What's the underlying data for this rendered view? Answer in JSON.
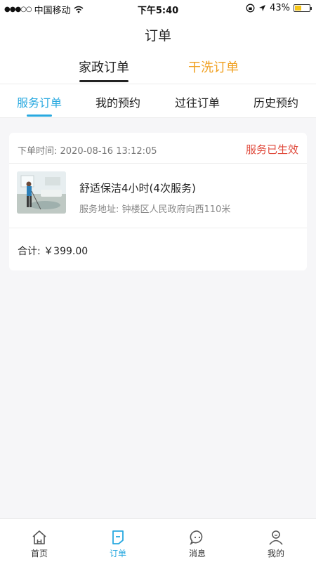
{
  "status_bar": {
    "carrier": "中国移动",
    "time": "下午5:40",
    "battery": "43%"
  },
  "nav": {
    "title": "订单"
  },
  "top_tabs": [
    {
      "label": "家政订单",
      "active": true
    },
    {
      "label": "干洗订单",
      "active": false
    }
  ],
  "sub_tabs": [
    {
      "label": "服务订单",
      "active": true
    },
    {
      "label": "我的预约",
      "active": false
    },
    {
      "label": "过往订单",
      "active": false
    },
    {
      "label": "历史预约",
      "active": false
    }
  ],
  "order": {
    "time_label": "下单时间: 2020-08-16 13:12:05",
    "status": "服务已生效",
    "item_title": "舒适保洁4小时(4次服务)",
    "item_address": "服务地址: 钟楼区人民政府向西110米",
    "total": "合计: ￥399.00"
  },
  "tab_bar": [
    {
      "label": "首页",
      "icon": "home-icon"
    },
    {
      "label": "订单",
      "icon": "order-icon"
    },
    {
      "label": "消息",
      "icon": "message-icon"
    },
    {
      "label": "我的",
      "icon": "profile-icon"
    }
  ],
  "colors": {
    "accent": "#29a9e0",
    "orange": "#f0a020",
    "status_red": "#e04a3c"
  }
}
